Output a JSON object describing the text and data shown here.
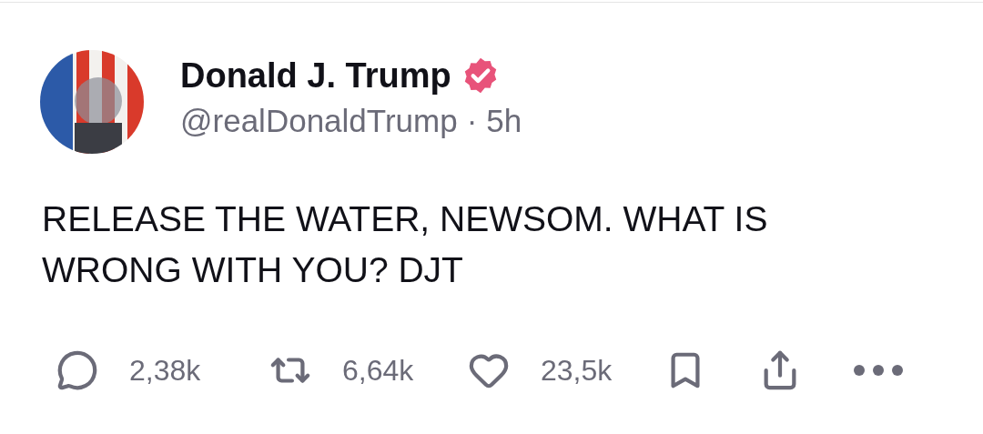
{
  "post": {
    "author": {
      "name": "Donald J. Trump",
      "verified": true,
      "handle": "@realDonaldTrump",
      "separator": "·",
      "time": "5h"
    },
    "text": "RELEASE THE WATER, NEWSOM. WHAT IS WRONG WITH YOU? DJT",
    "actions": [
      {
        "kind": "reply",
        "count": "2,38k"
      },
      {
        "kind": "repost",
        "count": "6,64k"
      },
      {
        "kind": "like",
        "count": "23,5k"
      },
      {
        "kind": "bookmark"
      },
      {
        "kind": "share"
      },
      {
        "kind": "more"
      }
    ]
  }
}
